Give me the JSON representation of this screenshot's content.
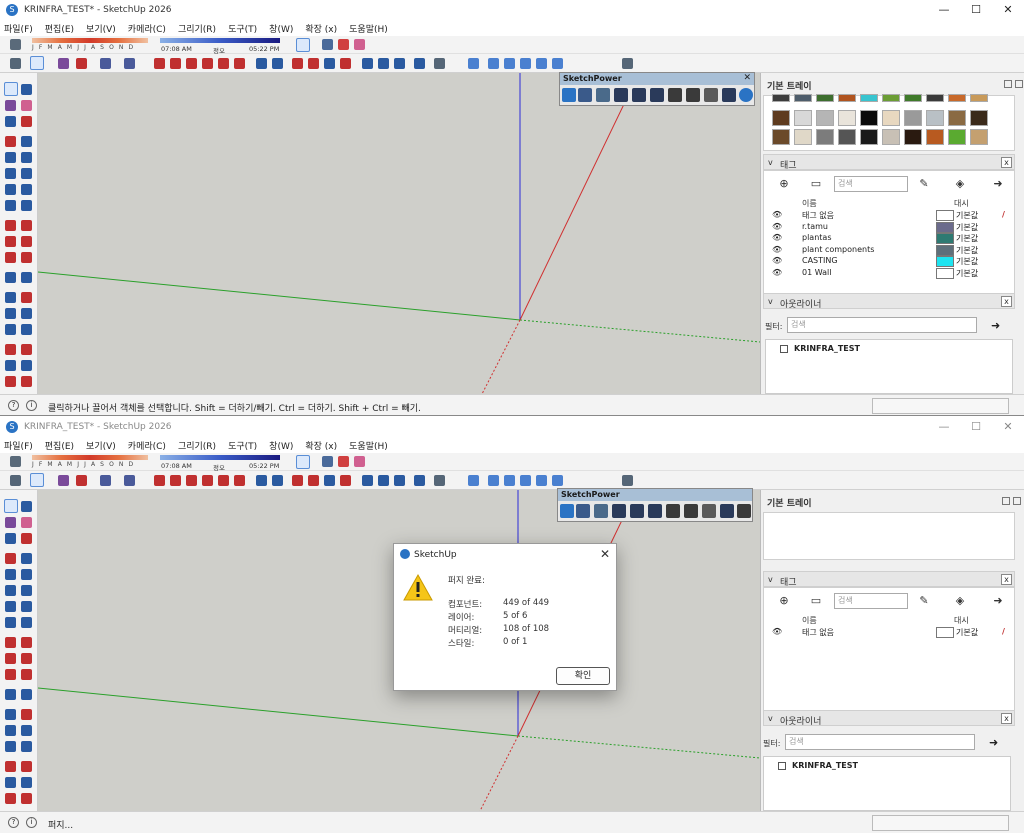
{
  "windows": [
    {
      "title": "KRINFRA_TEST* - SketchUp 2026",
      "status_text": "클릭하거나 끌어서 객체를 선택합니다. Shift = 더하기/빼기. Ctrl = 더하기. Shift + Ctrl = 빼기."
    },
    {
      "title": "KRINFRA_TEST* - SketchUp 2026",
      "status_text": "퍼지..."
    }
  ],
  "window_controls": {
    "minimize": "—",
    "maximize": "☐",
    "close": "✕"
  },
  "menu": [
    "파일(F)",
    "편집(E)",
    "보기(V)",
    "카메라(C)",
    "그리기(R)",
    "도구(T)",
    "창(W)",
    "확장 (x)",
    "도움말(H)"
  ],
  "shadows": {
    "months": "J F M A M J J A S O N D",
    "time_start": "07:08 AM",
    "time_noon": "정오",
    "time_end": "05:22 PM"
  },
  "sketchpower": {
    "title": "SketchPower",
    "close": "✕"
  },
  "tray": {
    "title": "기본 트레이",
    "tags_panel": {
      "title": "태그",
      "search_placeholder": "검색",
      "col_name": "이름",
      "col_dash": "대시",
      "tags_w1": [
        {
          "name": "태그 없음",
          "dash": "기본값",
          "color": "#ffffff"
        },
        {
          "name": "r.tamu",
          "dash": "기본값",
          "color": "#6b6b8c"
        },
        {
          "name": "plantas",
          "dash": "기본값",
          "color": "#2e7a72"
        },
        {
          "name": "plant components",
          "dash": "기본값",
          "color": "#5e6f7a"
        },
        {
          "name": "CASTING",
          "dash": "기본값",
          "color": "#1ee4f0"
        },
        {
          "name": "01 Wall",
          "dash": "기본값",
          "color": "#ffffff"
        }
      ],
      "tags_w2": [
        {
          "name": "태그 없음",
          "dash": "기본값",
          "color": "#ffffff"
        }
      ]
    },
    "outliner_panel": {
      "title": "아웃라이너",
      "filter_label": "필터:",
      "search_placeholder": "검색",
      "root": "KRINFRA_TEST"
    },
    "materials": [
      "#3c3c3c",
      "#4e5d6b",
      "#3d6e2e",
      "#b0541f",
      "#38c4cf",
      "#6b9d34",
      "#3f7a2a",
      "#3a3a3a",
      "#c8692a",
      "#c89a5a",
      "#5e3b1f",
      "#d8d8d8",
      "#b5b5b5",
      "#e9e4db",
      "#0a0a0a",
      "#e8d8c0",
      "#9a9a9a",
      "#b9c0c5",
      "#8a6a43",
      "#3a2a1a",
      "#6b4a2a",
      "#e0d8c8",
      "#7c7c7c",
      "#555555",
      "#1a1a1a",
      "#c8c0b5",
      "#2a1a10",
      "#b85a20",
      "#5aaa30",
      "#c4a070"
    ]
  },
  "dialog": {
    "title": "SketchUp",
    "heading": "퍼지 완료:",
    "rows": [
      {
        "label": "컴포넌트:",
        "value": "449 of 449"
      },
      {
        "label": "레이어:",
        "value": "5 of 6"
      },
      {
        "label": "머티리얼:",
        "value": "108 of 108"
      },
      {
        "label": "스타일:",
        "value": "0 of 1"
      }
    ],
    "ok_label": "확인",
    "close": "✕"
  }
}
